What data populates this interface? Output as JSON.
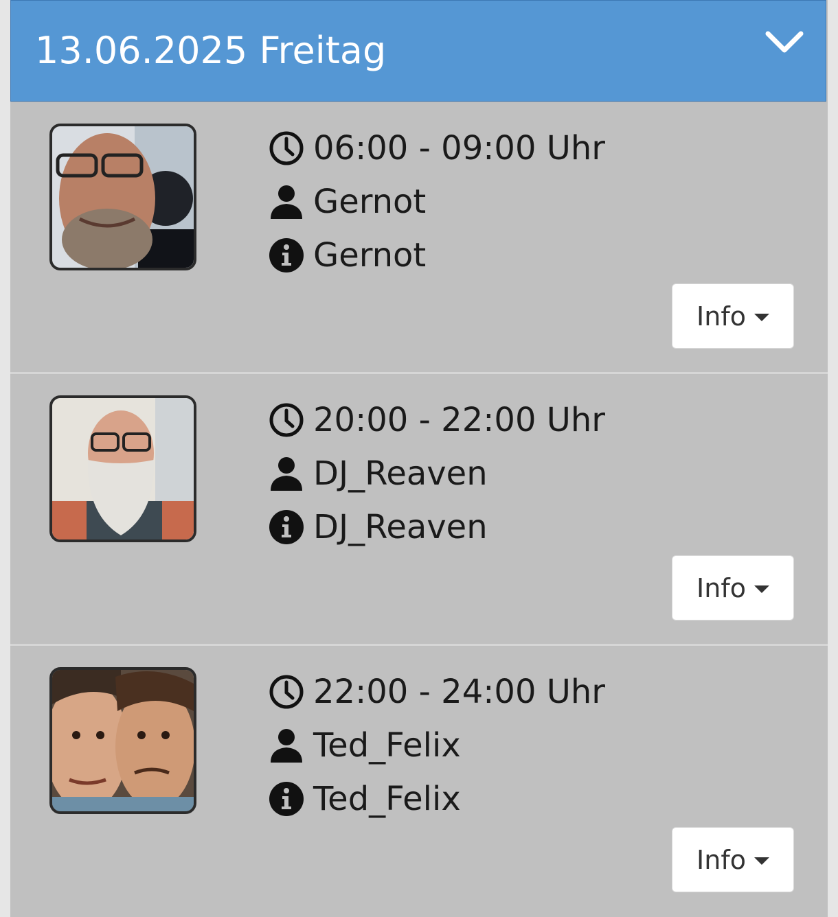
{
  "header": {
    "title": "13.06.2025 Freitag",
    "toggle_icon": "chevron-down-icon",
    "background": "#5597d4"
  },
  "slots": [
    {
      "time": "06:00 - 09:00 Uhr",
      "host": "Gernot",
      "show": "Gernot",
      "button_label": "Info"
    },
    {
      "time": "20:00 - 22:00 Uhr",
      "host": "DJ_Reaven",
      "show": "DJ_Reaven",
      "button_label": "Info"
    },
    {
      "time": "22:00 - 24:00 Uhr",
      "host": "Ted_Felix",
      "show": "Ted_Felix",
      "button_label": "Info"
    }
  ],
  "icons": {
    "time": "clock-icon",
    "host": "user-icon",
    "show": "info-circle-icon",
    "button": "caret-down-icon"
  }
}
